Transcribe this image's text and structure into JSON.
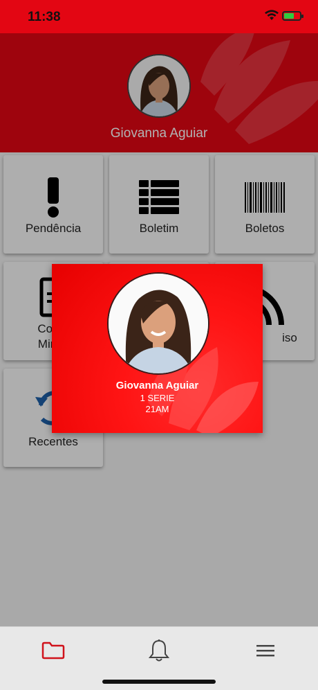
{
  "status_bar": {
    "time": "11:38",
    "icons": [
      "wifi-icon",
      "battery-icon"
    ]
  },
  "profile": {
    "name": "Giovanna Aguiar"
  },
  "tiles": [
    {
      "label": "Pendência",
      "icon": "exclamation-icon"
    },
    {
      "label": "Boletim",
      "icon": "table-icon"
    },
    {
      "label": "Boletos",
      "icon": "barcode-icon"
    },
    {
      "label_line1": "Conte",
      "label_line2": "Minist",
      "icon": "document-icon"
    },
    {
      "label": "iso",
      "icon": "rss-icon"
    },
    {
      "label": "Recentes",
      "icon": "refresh-icon"
    }
  ],
  "modal": {
    "name": "Giovanna Aguiar",
    "grade": "1 SERIE",
    "class": "21AM"
  },
  "tabbar": {
    "items": [
      "folder-icon",
      "bell-icon",
      "menu-icon"
    ]
  },
  "colors": {
    "brand": "#e30613",
    "tab_active": "#d0121b",
    "icon_blue": "#1e5fa8"
  }
}
